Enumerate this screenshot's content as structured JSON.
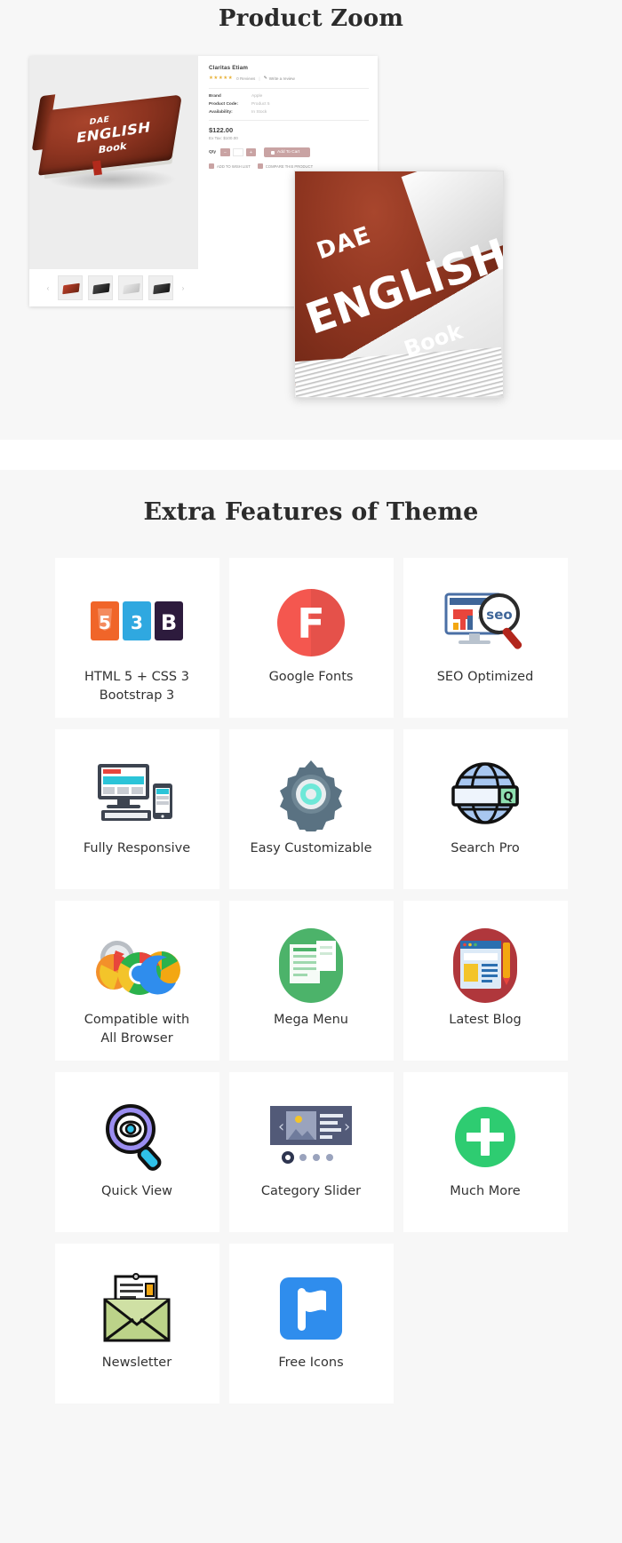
{
  "zoom_section": {
    "title": "Product Zoom",
    "product": {
      "name": "Claritas Etiam",
      "stars": "★★★★★",
      "reviews": "0 Reviews",
      "separator": "|",
      "write_review": "Write a review",
      "specs": [
        {
          "key": "Brand",
          "value": "Apple"
        },
        {
          "key": "Product Code:",
          "value": "Product 5"
        },
        {
          "key": "Availability:",
          "value": "In Stock"
        }
      ],
      "price": "$122.00",
      "ex_tax": "Ex Tax: $100.00",
      "qty_label": "Qty",
      "qty_minus": "−",
      "qty_plus": "+",
      "qty_value": "1",
      "add_to_cart": "Add To Cart",
      "add_to_wishlist": "ADD TO WISH LIST",
      "compare": "COMPARE THIS PRODUCT",
      "book_line1": "DAE",
      "book_line2": "ENGLISH",
      "book_line3": "Book"
    },
    "thumbnails": {
      "prev": "‹",
      "next": "›",
      "items": [
        "thumb-book-red",
        "thumb-book-dark",
        "thumb-book-pale",
        "thumb-book-dark2"
      ]
    },
    "lens": {
      "line1": "DAE",
      "line2": "ENGLISH",
      "line3": "Book"
    }
  },
  "features_section": {
    "title": "Extra Features of Theme",
    "cards": [
      {
        "label": "HTML 5 + CSS 3\nBootstrap 3",
        "icon": "html5-css3-bootstrap-icon"
      },
      {
        "label": "Google Fonts",
        "icon": "google-fonts-icon"
      },
      {
        "label": "SEO Optimized",
        "icon": "seo-optimized-icon"
      },
      {
        "label": "Fully Responsive",
        "icon": "responsive-devices-icon"
      },
      {
        "label": "Easy Customizable",
        "icon": "gear-icon"
      },
      {
        "label": "Search Pro",
        "icon": "globe-search-icon"
      },
      {
        "label": "Compatible with\nAll Browser",
        "icon": "browsers-icon"
      },
      {
        "label": "Mega Menu",
        "icon": "mega-menu-icon"
      },
      {
        "label": "Latest Blog",
        "icon": "latest-blog-icon"
      },
      {
        "label": "Quick View",
        "icon": "quick-view-icon"
      },
      {
        "label": "Category Slider",
        "icon": "category-slider-icon"
      },
      {
        "label": "Much More",
        "icon": "plus-circle-icon"
      },
      {
        "label": "Newsletter",
        "icon": "newsletter-envelope-icon"
      },
      {
        "label": "Free Icons",
        "icon": "flag-icon"
      }
    ],
    "html5_badge": "5",
    "css3_badge": "3",
    "bootstrap_badge": "B",
    "google_fonts_badge": "F",
    "seo_badge": "seo",
    "search_badge": "Q",
    "plus_badge": "+"
  },
  "colors": {
    "page_bg": "#f7f7f7",
    "card_bg": "#ffffff",
    "heading": "#2b2b2b",
    "label": "#333333",
    "accent_rose": "#c9a3a3",
    "html5_orange": "#f06529",
    "css3_blue": "#2fa8e0",
    "bootstrap_purple": "#2d1b3d",
    "google_fonts_red": "#f4574f",
    "green": "#2ecc71",
    "blue": "#2f8ded"
  }
}
